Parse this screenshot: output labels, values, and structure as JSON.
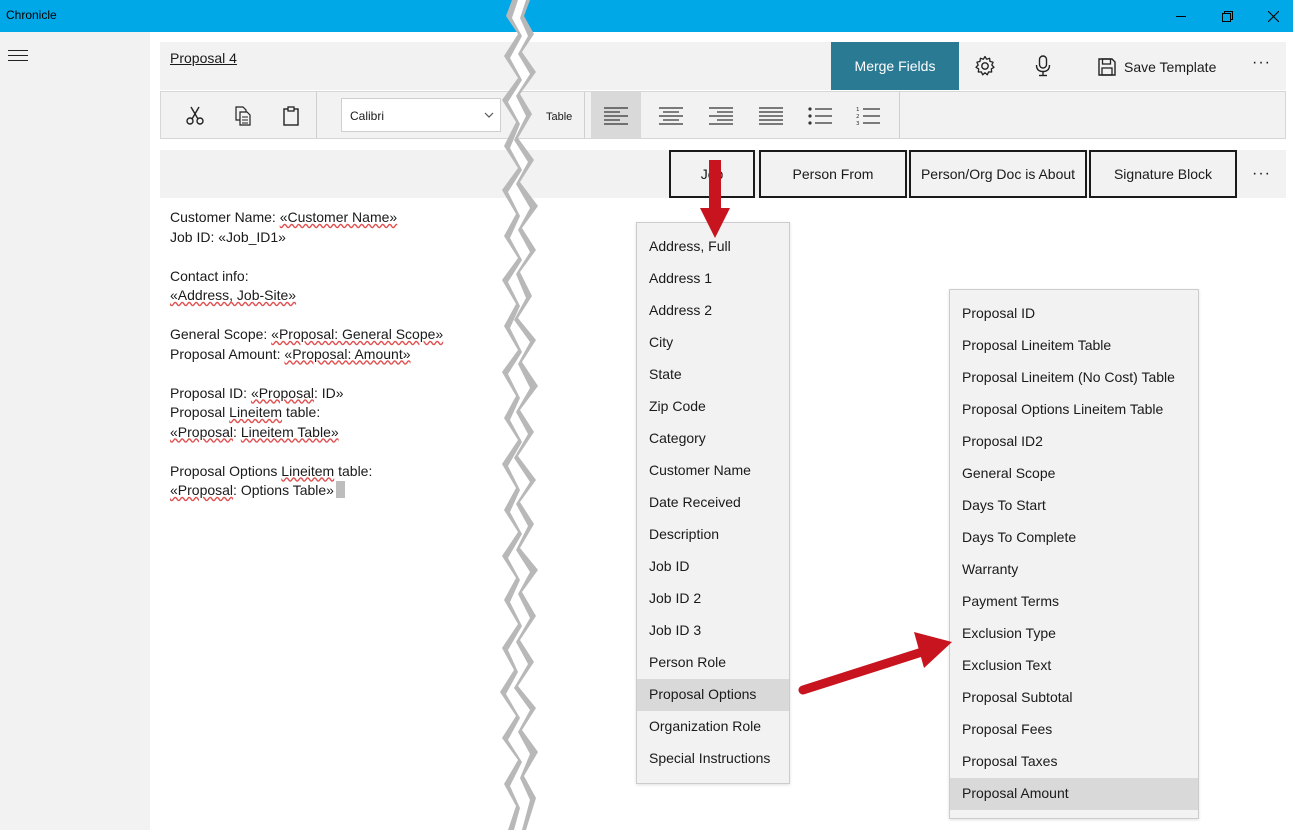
{
  "window": {
    "app_title": "Chronicle",
    "controls": [
      "minimize-icon",
      "restore-icon",
      "close-icon"
    ]
  },
  "header": {
    "document_title": "Proposal 4",
    "merge_fields_label": "Merge Fields",
    "save_template_label": "Save Template",
    "more_label": "···"
  },
  "toolbar": {
    "font_name": "Calibri",
    "table_label": "Table",
    "icons": [
      "cut-icon",
      "copy-icon",
      "paste-icon",
      "align-left-icon",
      "align-center-icon",
      "align-right-icon",
      "justify-icon",
      "bullet-list-icon",
      "numbered-list-icon"
    ]
  },
  "categories": {
    "items": [
      "Job",
      "Person From",
      "Person/Org Doc is About",
      "Signature Block"
    ],
    "more_label": "···"
  },
  "document": {
    "customer_label": "Customer Name:  ",
    "customer_field": "«Customer Name»",
    "jobid_label": "Job ID:  ",
    "jobid_field": "«Job_ID1»",
    "contact_label": "Contact info:",
    "address_field": "«Address, Job-Site»",
    "scope_label": "General Scope:  ",
    "scope_field": "«Proposal: General Scope»",
    "amount_label": "Proposal Amount:  ",
    "amount_field": "«Proposal: Amount»",
    "propid_label": "Proposal ID:  ",
    "propid_field_a": "«Proposal",
    "propid_field_b": ": ID»",
    "lineitem_pre": "Proposal ",
    "lineitem_word": "Lineitem",
    "lineitem_post": " table:",
    "lineitem_field_a": "«Proposal",
    "lineitem_field_mid": ": ",
    "lineitem_field_b": "Lineitem Table»",
    "options_pre": "Proposal Options ",
    "options_word": "Lineitem",
    "options_post": " table:",
    "options_field_a": "«Proposal",
    "options_field_b": ": Options Table»"
  },
  "job_menu": {
    "items": [
      "Address, Full",
      "Address 1",
      "Address 2",
      "City",
      "State",
      "Zip Code",
      "Category",
      "Customer Name",
      "Date Received",
      "Description",
      "Job ID",
      "Job ID 2",
      "Job ID 3",
      "Person Role",
      "Proposal Options",
      "Organization Role",
      "Special Instructions"
    ],
    "highlighted": "Proposal Options"
  },
  "proposal_menu": {
    "items": [
      "Proposal ID",
      "Proposal Lineitem Table",
      "Proposal Lineitem (No Cost) Table",
      "Proposal Options Lineitem Table",
      "Proposal ID2",
      "General Scope",
      "Days To Start",
      "Days To Complete",
      "Warranty",
      "Payment Terms",
      "Exclusion Type",
      "Exclusion Text",
      "Proposal Subtotal",
      "Proposal Fees",
      "Proposal Taxes",
      "Proposal Amount"
    ],
    "highlighted": "Proposal Amount"
  },
  "colors": {
    "titlebar": "#00a8e8",
    "merge_button": "#2b7a94",
    "arrow": "#c8141e",
    "highlight": "#d9d9d9"
  }
}
